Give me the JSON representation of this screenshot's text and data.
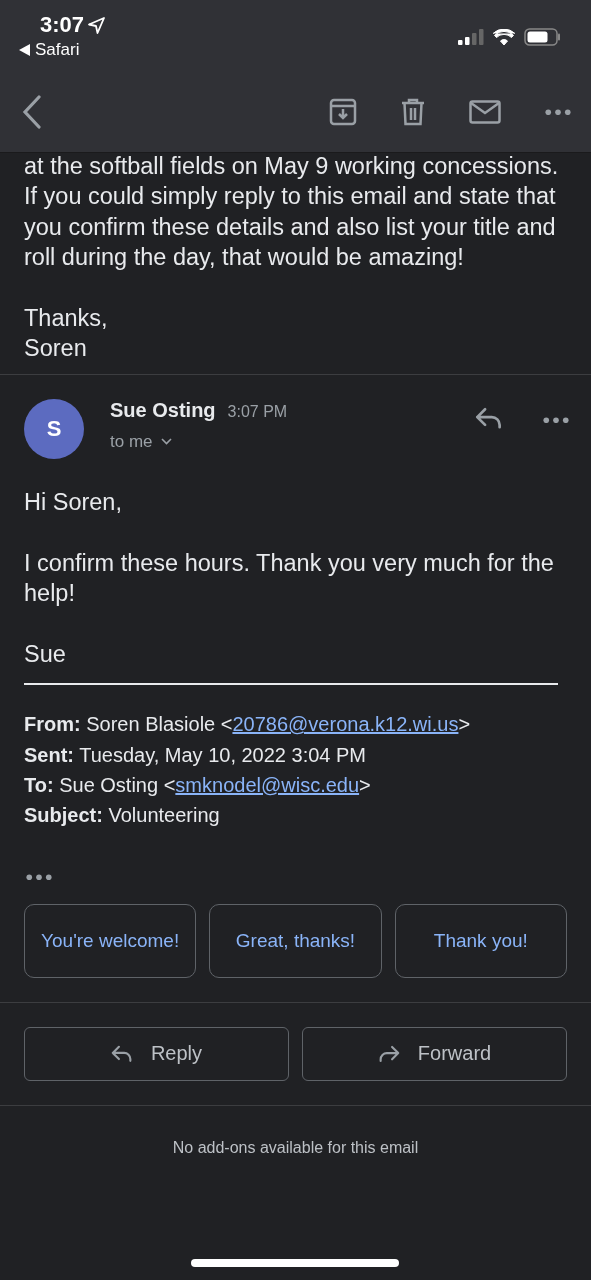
{
  "status_bar": {
    "time": "3:07",
    "back_label": "Safari"
  },
  "previous_message": {
    "paragraphs": [
      {
        "lines": [
          "at the softball fields on May 9 working concessions. If you could simply reply to this email and state that you confirm these details and also list your title and roll during the day, that would be amazing!"
        ]
      },
      {
        "lines": [
          "Thanks,",
          "Soren"
        ]
      }
    ]
  },
  "message": {
    "avatar_letter": "S",
    "sender": "Sue Osting",
    "time": "3:07 PM",
    "recipient": "to me",
    "paragraphs": [
      {
        "lines": [
          "Hi Soren,"
        ]
      },
      {
        "lines": [
          "I confirm these hours. Thank you very much for the help!"
        ]
      },
      {
        "lines": [
          "Sue"
        ]
      }
    ],
    "quoted_header": [
      {
        "label": "From:",
        "text": " Soren Blasiole <",
        "email": "20786@verona.k12.wi.us",
        "suffix": ">"
      },
      {
        "label": "Sent:",
        "text": " Tuesday, May 10, 2022 3:04 PM"
      },
      {
        "label": "To:",
        "text": " Sue Osting <",
        "email": "smknodel@wisc.edu",
        "suffix": ">"
      },
      {
        "label": "Subject:",
        "text": " Volunteering"
      }
    ]
  },
  "smart_replies": [
    {
      "label": "You're welcome!"
    },
    {
      "label": "Great, thanks!"
    },
    {
      "label": "Thank you!"
    }
  ],
  "actions": [
    {
      "kind": "reply",
      "label": "Reply"
    },
    {
      "kind": "forward",
      "label": "Forward"
    }
  ],
  "footer_note": "No add-ons available for this email"
}
